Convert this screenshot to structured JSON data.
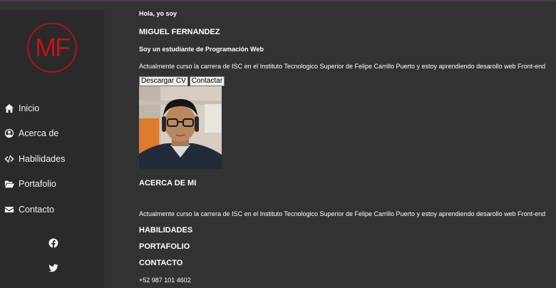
{
  "logo": {
    "initials": "MF",
    "color": "#c0111d"
  },
  "nav": [
    {
      "label": "Inicio",
      "icon": "home-icon"
    },
    {
      "label": "Acerca de",
      "icon": "user-circle-icon"
    },
    {
      "label": "Habilidades",
      "icon": "code-icon"
    },
    {
      "label": "Portafolio",
      "icon": "folder-open-icon"
    },
    {
      "label": "Contacto",
      "icon": "envelope-icon"
    }
  ],
  "social": [
    "facebook-icon",
    "twitter-icon"
  ],
  "hero": {
    "greeting": "Hola, yo soy",
    "name": "MIGUEL FERNANDEZ",
    "subtitle": "Soy un estudiante de Programación Web",
    "description": "Actualmente curso la carrera de ISC en el Instituto Tecnologico Superior de Felipe Carrillo Puerto y estoy aprendiendo desarollo web Front-end",
    "download_cv": "Descargar CV",
    "contact": "Contactar"
  },
  "about": {
    "heading": "ACERCA DE MI",
    "text": "Actualmente curso la carrera de ISC en el Instituto Tecnologico Superior de Felipe Carrillo Puerto y estoy aprendiendo desarollo web Front-end"
  },
  "skills": {
    "heading": "HABILIDADES"
  },
  "portfolio": {
    "heading": "PORTAFOLIO"
  },
  "contact": {
    "heading": "CONTACTO",
    "phone": "+52 987 101 4602"
  }
}
